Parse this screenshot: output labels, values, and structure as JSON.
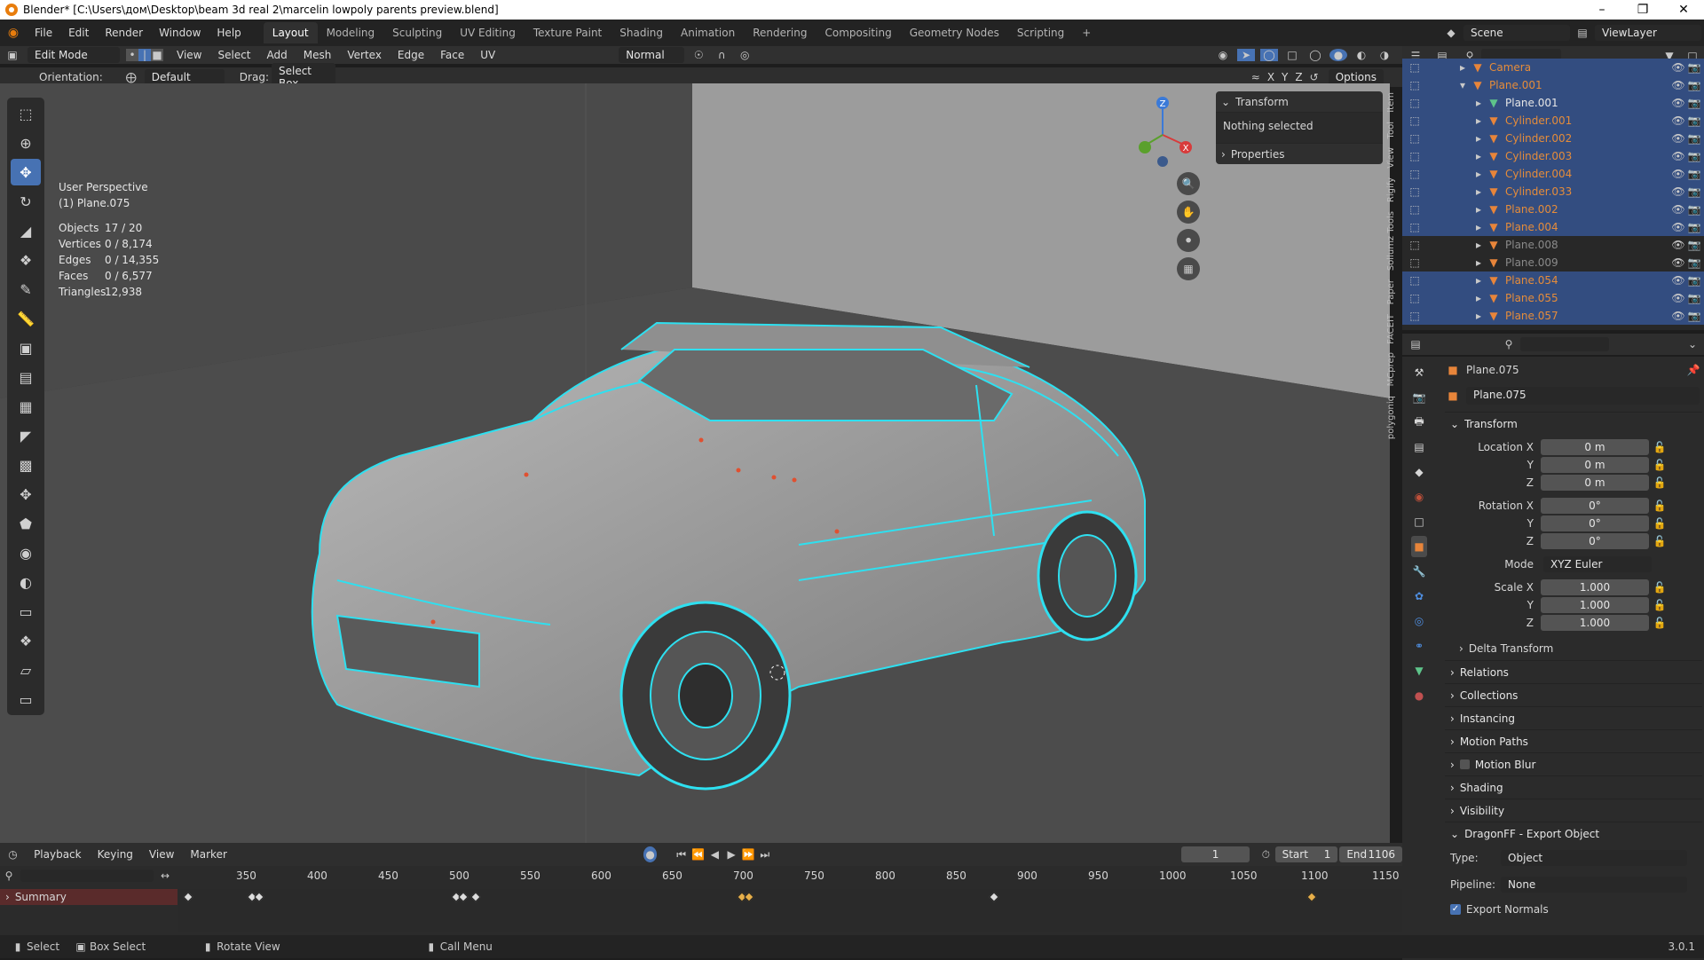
{
  "window": {
    "title": "Blender* [C:\\Users\\дом\\Desktop\\beam 3d real 2\\marcelin lowpoly parents preview.blend]"
  },
  "menus": [
    "File",
    "Edit",
    "Render",
    "Window",
    "Help"
  ],
  "workspaces": [
    "Layout",
    "Modeling",
    "Sculpting",
    "UV Editing",
    "Texture Paint",
    "Shading",
    "Animation",
    "Rendering",
    "Compositing",
    "Geometry Nodes",
    "Scripting"
  ],
  "active_workspace": "Layout",
  "scene": {
    "label": "Scene",
    "viewlayer": "ViewLayer"
  },
  "viewport_header": {
    "mode": "Edit Mode",
    "menus": [
      "View",
      "Select",
      "Add",
      "Mesh",
      "Vertex",
      "Edge",
      "Face",
      "UV"
    ],
    "orientation_pivot": "Normal"
  },
  "tool_settings": {
    "orientation_label": "Orientation:",
    "orientation": "Default",
    "drag_label": "Drag:",
    "drag": "Select Box",
    "axes": [
      "X",
      "Y",
      "Z"
    ],
    "options": "Options"
  },
  "viewport": {
    "perspective": "User Perspective",
    "object": "(1) Plane.075",
    "stats": [
      {
        "label": "Objects",
        "value": "17 / 20"
      },
      {
        "label": "Vertices",
        "value": "0 / 8,174"
      },
      {
        "label": "Edges",
        "value": "0 / 14,355"
      },
      {
        "label": "Faces",
        "value": "0 / 6,577"
      },
      {
        "label": "Triangles",
        "value": "12,938"
      }
    ],
    "gizmo_axes": [
      "Z",
      "X"
    ]
  },
  "npanel": {
    "transform": "Transform",
    "nothing_selected": "Nothing selected",
    "properties": "Properties"
  },
  "side_tabs": [
    "Item",
    "Tool",
    "View",
    "Rigify",
    "Sollumz Tools",
    "Paper",
    "FACEIT",
    "MCprep",
    "polygoniq"
  ],
  "outliner": [
    {
      "name": "Camera",
      "indent": 1,
      "style": "orange",
      "selected": true
    },
    {
      "name": "Plane.001",
      "indent": 1,
      "style": "orange",
      "selected": true,
      "expanded": true
    },
    {
      "name": "Plane.001",
      "indent": 2,
      "style": "white",
      "selected": true
    },
    {
      "name": "Cylinder.001",
      "indent": 2,
      "style": "orange",
      "selected": true
    },
    {
      "name": "Cylinder.002",
      "indent": 2,
      "style": "orange",
      "selected": true
    },
    {
      "name": "Cylinder.003",
      "indent": 2,
      "style": "orange",
      "selected": true
    },
    {
      "name": "Cylinder.004",
      "indent": 2,
      "style": "orange",
      "selected": true
    },
    {
      "name": "Cylinder.033",
      "indent": 2,
      "style": "orange",
      "selected": true
    },
    {
      "name": "Plane.002",
      "indent": 2,
      "style": "orange",
      "selected": true
    },
    {
      "name": "Plane.004",
      "indent": 2,
      "style": "orange",
      "selected": true
    },
    {
      "name": "Plane.008",
      "indent": 2,
      "style": "dim",
      "selected": false
    },
    {
      "name": "Plane.009",
      "indent": 2,
      "style": "dim",
      "selected": false
    },
    {
      "name": "Plane.054",
      "indent": 2,
      "style": "orange",
      "selected": true
    },
    {
      "name": "Plane.055",
      "indent": 2,
      "style": "orange",
      "selected": true
    },
    {
      "name": "Plane.057",
      "indent": 2,
      "style": "orange",
      "selected": true
    }
  ],
  "properties": {
    "object_name": "Plane.075",
    "datablock": "Plane.075",
    "transform": "Transform",
    "location_label": "Location X",
    "location": [
      "0 m",
      "0 m",
      "0 m"
    ],
    "rotation_label": "Rotation X",
    "rotation": [
      "0°",
      "0°",
      "0°"
    ],
    "mode_label": "Mode",
    "mode": "XYZ Euler",
    "scale_label": "Scale X",
    "scale": [
      "1.000",
      "1.000",
      "1.000"
    ],
    "y_label": "Y",
    "z_label": "Z",
    "delta": "Delta Transform",
    "sections": [
      "Relations",
      "Collections",
      "Instancing",
      "Motion Paths"
    ],
    "motion_blur": "Motion Blur",
    "sections2": [
      "Shading",
      "Visibility"
    ],
    "dragonff": "DragonFF - Export Object",
    "type_label": "Type:",
    "type": "Object",
    "pipeline_label": "Pipeline:",
    "pipeline": "None",
    "export_normals": "Export Normals"
  },
  "timeline": {
    "menus": [
      "Playback",
      "Keying",
      "View",
      "Marker"
    ],
    "current_frame": "1",
    "start_label": "Start",
    "start": "1",
    "end_label": "End",
    "end": "1106",
    "ticks": [
      "350",
      "400",
      "450",
      "500",
      "550",
      "600",
      "650",
      "700",
      "750",
      "800",
      "850",
      "900",
      "950",
      "1000",
      "1050",
      "1100",
      "1150"
    ],
    "summary": "Summary"
  },
  "statusbar": {
    "items": [
      "Select",
      "Box Select",
      "Rotate View",
      "Call Menu"
    ],
    "version": "3.0.1"
  }
}
